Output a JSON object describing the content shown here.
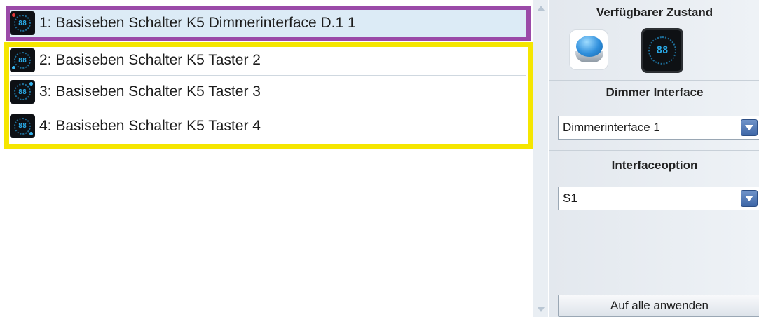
{
  "list": {
    "items": [
      {
        "label": "1: Basiseben Schalter K5 Dimmerinterface D.1 1",
        "icon": "dimmer-display-icon",
        "indicator_color": "#e23b3b"
      },
      {
        "label": "2: Basiseben Schalter K5 Taster 2",
        "icon": "dimmer-display-icon",
        "indicator_color": "#38b6f0"
      },
      {
        "label": "3: Basiseben Schalter K5 Taster 3",
        "icon": "dimmer-display-icon",
        "indicator_color": "#38b6f0"
      },
      {
        "label": "4: Basiseben Schalter K5 Taster 4",
        "icon": "dimmer-display-icon",
        "indicator_color": "#38b6f0"
      }
    ],
    "selected_index": 0,
    "selection_frame_color": "#9b4aa8",
    "group_frame_color": "#f5e600"
  },
  "panel": {
    "state_title": "Verfügbarer Zustand",
    "state_icons": [
      "push-button-icon",
      "dimmer-display-icon"
    ],
    "dimmer_interface_title": "Dimmer Interface",
    "dimmer_interface_value": "Dimmerinterface 1",
    "interface_option_title": "Interfaceoption",
    "interface_option_value": "S1",
    "apply_all_label": "Auf alle anwenden"
  },
  "icon_digits": "88"
}
